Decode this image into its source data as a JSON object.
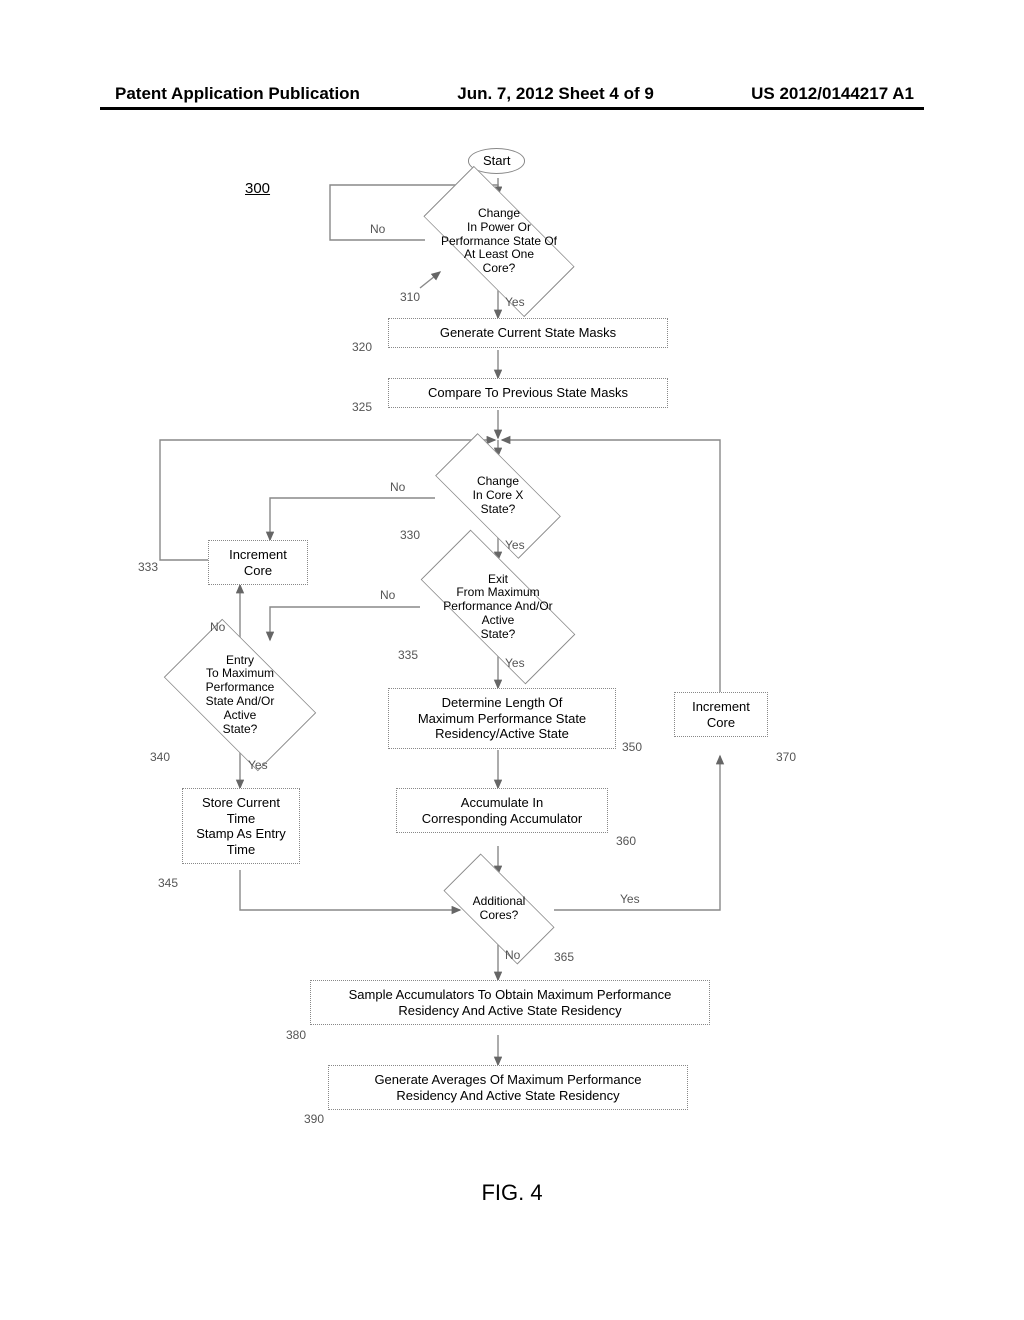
{
  "header": {
    "left": "Patent Application Publication",
    "center": "Jun. 7, 2012  Sheet 4 of 9",
    "right": "US 2012/0144217 A1"
  },
  "figure_label": "FIG. 4",
  "method_ref": "300",
  "nodes": {
    "start": "Start",
    "d310": "Change\nIn Power Or\nPerformance State Of\nAt Least One\nCore?",
    "r320": "Generate Current State Masks",
    "r325": "Compare To Previous State Masks",
    "d330": "Change\nIn Core X\nState?",
    "r333": "Increment\nCore",
    "d335": "Exit\nFrom Maximum\nPerformance And/Or\nActive\nState?",
    "d340": "Entry\nTo Maximum\nPerformance\nState And/Or\nActive\nState?",
    "r345": "Store Current\nTime\nStamp As Entry\nTime",
    "r350": "Determine Length Of\nMaximum Performance State\nResidency/Active State",
    "r360": "Accumulate In\nCorresponding Accumulator",
    "d365": "Additional\nCores?",
    "r370": "Increment\nCore",
    "r380": "Sample Accumulators To Obtain Maximum Performance\nResidency And Active State Residency",
    "r390": "Generate Averages Of Maximum Performance\nResidency And Active State Residency"
  },
  "refs": {
    "r310": "310",
    "r320": "320",
    "r325": "325",
    "r330": "330",
    "r333": "333",
    "r335": "335",
    "r340": "340",
    "r345": "345",
    "r350": "350",
    "r360": "360",
    "r365": "365",
    "r370": "370",
    "r380": "380",
    "r390": "390"
  },
  "edge_labels": {
    "yes": "Yes",
    "no": "No"
  }
}
